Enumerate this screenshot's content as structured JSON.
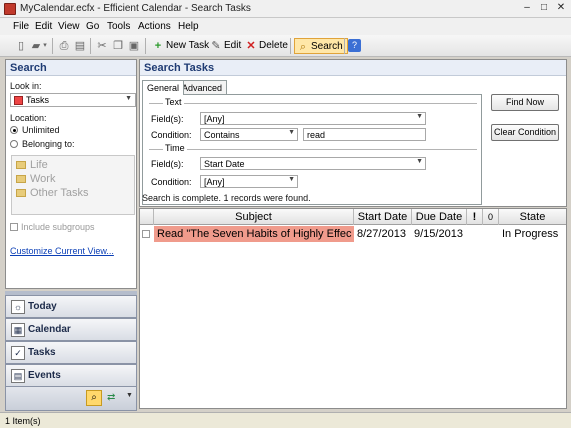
{
  "window": {
    "title": "MyCalendar.ecfx - Efficient Calendar - Search Tasks",
    "minimize": "–",
    "maximize": "□",
    "close": "✕"
  },
  "menu": [
    "File",
    "Edit",
    "View",
    "Go",
    "Tools",
    "Actions",
    "Help"
  ],
  "toolbar": {
    "new_task": "New Task",
    "edit": "Edit",
    "delete": "Delete",
    "search": "Search"
  },
  "left_panel": {
    "header": "Search",
    "look_in_label": "Look in:",
    "look_in_value": "Tasks",
    "location_label": "Location:",
    "unlimited": "Unlimited",
    "belonging_to": "Belonging to:",
    "folders": [
      "Life",
      "Work",
      "Other Tasks"
    ],
    "include_subgroups": "Include subgroups",
    "customize": "Customize Current View..."
  },
  "nav": {
    "today": "Today",
    "calendar": "Calendar",
    "tasks": "Tasks",
    "events": "Events"
  },
  "search_panel": {
    "header": "Search Tasks",
    "tabs": [
      "General",
      "Advanced"
    ],
    "text_group": "Text",
    "time_group": "Time",
    "text_fields_label": "Field(s):",
    "text_fields_value": "[Any]",
    "text_condition_label": "Condition:",
    "text_condition_value": "Contains",
    "text_query": "read",
    "time_field_label": "Field(s):",
    "time_field_value": "Start Date",
    "time_condition_label": "Condition:",
    "time_condition_value": "[Any]",
    "find_now": "Find Now",
    "clear_condition": "Clear Condition",
    "status_message": "Search is complete. 1 records were found."
  },
  "grid": {
    "columns": [
      "Subject",
      "Start Date",
      "Due Date",
      "!",
      "0",
      "State"
    ],
    "rows": [
      {
        "subject": "Read \"The Seven Habits of Highly Effec",
        "start_date": "8/27/2013",
        "due_date": "9/15/2013",
        "state": "In Progress"
      }
    ]
  },
  "statusbar": {
    "text": "1 Item(s)"
  },
  "colors": {
    "panel_header_text": "#1f3b73",
    "subject_highlight": "#f09b8c",
    "link": "#0b3fb6"
  }
}
